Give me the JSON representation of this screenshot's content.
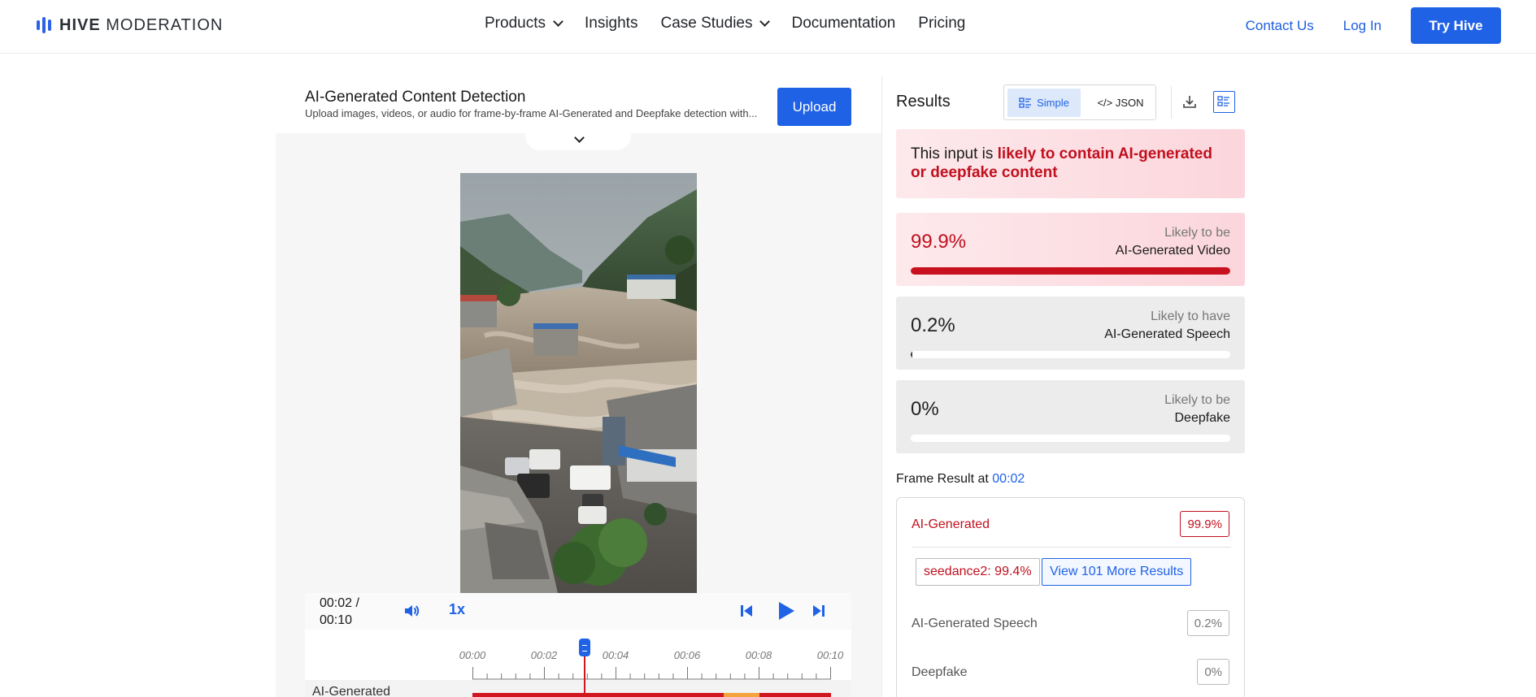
{
  "nav": {
    "brand_bold": "HIVE",
    "brand_light": "MODERATION",
    "links": [
      {
        "label": "Products",
        "dropdown": true
      },
      {
        "label": "Insights",
        "dropdown": false
      },
      {
        "label": "Case Studies",
        "dropdown": true
      },
      {
        "label": "Documentation",
        "dropdown": false
      },
      {
        "label": "Pricing",
        "dropdown": false
      }
    ],
    "contact": "Contact Us",
    "login": "Log In",
    "try": "Try Hive",
    "accent": "#1f62e6"
  },
  "detector": {
    "title": "AI-Generated Content Detection",
    "subtitle": "Upload images, videos, or audio for frame-by-frame AI-Generated and Deepfake detection with...",
    "upload": "Upload"
  },
  "player": {
    "time_current": "00:02 /",
    "time_total": "00:10",
    "speed": "1x",
    "timeline_ticks": [
      "00:00",
      "00:02",
      "00:04",
      "00:06",
      "00:08",
      "00:10"
    ],
    "playhead_fraction": 0.22,
    "track_label": "AI-Generated",
    "track_segments": [
      {
        "start": 0.0,
        "end": 0.7,
        "color": "#d0161e"
      },
      {
        "start": 0.7,
        "end": 0.8,
        "color": "#f5a33c"
      },
      {
        "start": 0.8,
        "end": 1.0,
        "color": "#d0161e"
      }
    ]
  },
  "results": {
    "title": "Results",
    "view_simple": "Simple",
    "view_json": "</> JSON",
    "verdict_prefix": "This input is ",
    "verdict_hot": "likely to contain AI-generated or deepfake content",
    "scores": [
      {
        "value": "99.9%",
        "cap1": "Likely to be",
        "cap2": "AI-Generated Video",
        "fraction": 0.999,
        "fill": "#c8101e",
        "val_color": "#c0101e",
        "bg": "linear-gradient(90deg,#fde9ec 0%,#fbd6dc 100%)"
      },
      {
        "value": "0.2%",
        "cap1": "Likely to have",
        "cap2": "AI-Generated Speech",
        "fraction": 0.002,
        "fill": "#333333",
        "val_color": "#222222",
        "bg": "#ececec"
      },
      {
        "value": "0%",
        "cap1": "Likely to be",
        "cap2": "Deepfake",
        "fraction": 0.0,
        "fill": "#333333",
        "val_color": "#222222",
        "bg": "#ececec"
      }
    ],
    "frame_prefix": "Frame Result at ",
    "frame_time": "00:02",
    "frame": {
      "ai_label": "AI-Generated",
      "ai_value": "99.9%",
      "model_chip": "seedance2: 99.4%",
      "more_chip": "View 101 More Results",
      "speech_label": "AI-Generated Speech",
      "speech_value": "0.2%",
      "deepfake_label": "Deepfake",
      "deepfake_value": "0%"
    }
  }
}
